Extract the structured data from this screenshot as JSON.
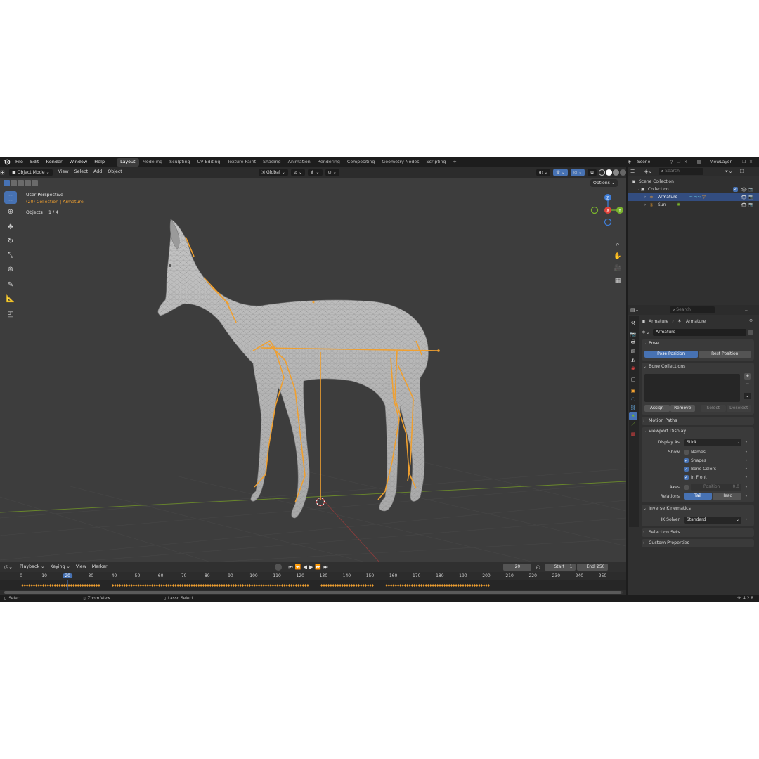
{
  "menu": {
    "items": [
      "File",
      "Edit",
      "Render",
      "Window",
      "Help"
    ],
    "workspaces": [
      "Layout",
      "Modeling",
      "Sculpting",
      "UV Editing",
      "Texture Paint",
      "Shading",
      "Animation",
      "Rendering",
      "Compositing",
      "Geometry Nodes",
      "Scripting"
    ],
    "active_workspace": "Layout",
    "add_tab": "+",
    "scene": "Scene",
    "view_layer": "ViewLayer"
  },
  "viewport": {
    "mode": "Object Mode",
    "menus": [
      "View",
      "Select",
      "Add",
      "Object"
    ],
    "orientation": "Global",
    "options": "Options",
    "view_name": "User Perspective",
    "collection_info": "(20) Collection | Armature",
    "objects_label": "Objects",
    "objects_count": "1 / 4"
  },
  "outliner": {
    "search_placeholder": "Search",
    "scene_collection": "Scene Collection",
    "collection": "Collection",
    "items": [
      {
        "name": "Armature",
        "selected": true
      },
      {
        "name": "Sun",
        "selected": false
      }
    ]
  },
  "properties": {
    "search_placeholder": "Search",
    "breadcrumb": [
      "Armature",
      "Armature"
    ],
    "data_name": "Armature",
    "pose": {
      "title": "Pose",
      "pose_position": "Pose Position",
      "rest_position": "Rest Position"
    },
    "bone_collections": {
      "title": "Bone Collections",
      "assign": "Assign",
      "remove": "Remove",
      "select": "Select",
      "deselect": "Deselect"
    },
    "motion_paths": "Motion Paths",
    "viewport_display": {
      "title": "Viewport Display",
      "display_as_label": "Display As",
      "display_as_value": "Stick",
      "show_label": "Show",
      "names": "Names",
      "shapes": "Shapes",
      "bone_colors": "Bone Colors",
      "in_front": "In Front",
      "axes_label": "Axes",
      "position_label": "Position",
      "position_value": "0.0",
      "relations_label": "Relations",
      "tail": "Tail",
      "head": "Head"
    },
    "inverse_kinematics": {
      "title": "Inverse Kinematics",
      "ik_solver_label": "IK Solver",
      "ik_solver_value": "Standard"
    },
    "selection_sets": "Selection Sets",
    "custom_properties": "Custom Properties"
  },
  "timeline": {
    "menus": [
      "Playback",
      "Keying",
      "View",
      "Marker"
    ],
    "current_frame": "20",
    "start_label": "Start",
    "start_value": "1",
    "end_label": "End",
    "end_value": "250",
    "ruler": [
      "0",
      "10",
      "20",
      "30",
      "40",
      "50",
      "60",
      "70",
      "80",
      "90",
      "100",
      "110",
      "120",
      "130",
      "140",
      "150",
      "160",
      "170",
      "180",
      "190",
      "200",
      "210",
      "220",
      "230",
      "240",
      "250"
    ]
  },
  "status": {
    "select": "Select",
    "zoom_view": "Zoom View",
    "lasso_select": "Lasso Select",
    "version": "4.2.8"
  },
  "colors": {
    "accent": "#4772b3",
    "bone": "#f0a030",
    "x_axis": "#e0443c",
    "y_axis": "#7ab32c",
    "z_axis": "#3f7dd6"
  }
}
